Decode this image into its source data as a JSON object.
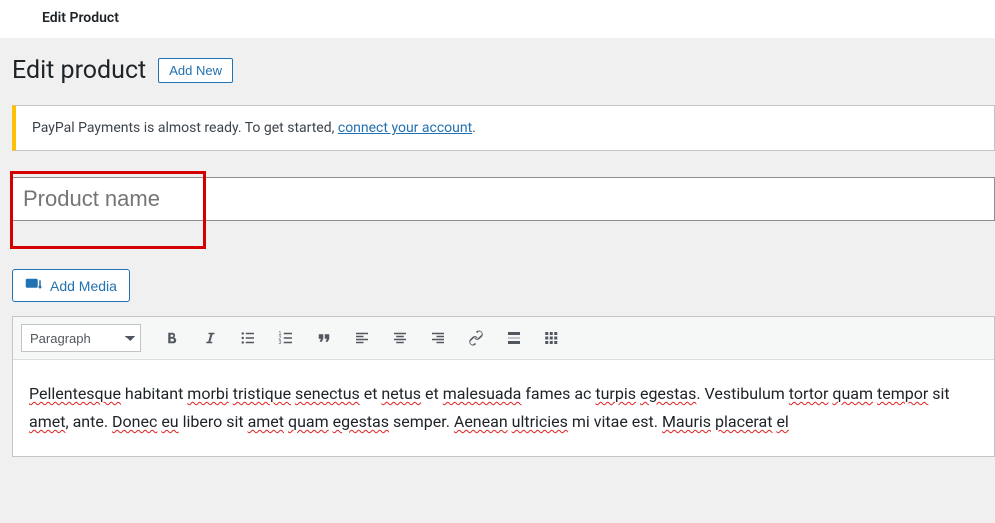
{
  "top_bar": {
    "breadcrumb": "Edit Product"
  },
  "heading": {
    "title": "Edit product",
    "add_new_label": "Add New"
  },
  "notice": {
    "text_before": "PayPal Payments is almost ready. To get started, ",
    "link_text": "connect your account",
    "text_after": "."
  },
  "title_input": {
    "placeholder": "Product name"
  },
  "add_media_label": "Add Media",
  "toolbar": {
    "format_selected": "Paragraph"
  },
  "content": {
    "w1": "Pellentesque",
    "t1": " habitant ",
    "w2": "morbi",
    "t2": " ",
    "w3": "tristique",
    "t3": " ",
    "w4": "senectus",
    "t4": " et ",
    "w5": "netus",
    "t5": " et ",
    "w6": "malesuada",
    "t6": " fames ac ",
    "w7": "turpis",
    "t7": " ",
    "w8": "egestas",
    "t8": ". Vestibulum ",
    "w9": "tortor",
    "t9": " ",
    "w10": "quam",
    "t10": " ",
    "w11": "tempor",
    "t11": " sit ",
    "w12": "amet",
    "t12": ", ante. ",
    "w13": "Donec",
    "t13": " ",
    "w14": "eu",
    "t14": " libero sit ",
    "w15": "amet",
    "t15": " ",
    "w16": "quam",
    "t16": " ",
    "w17": "egestas",
    "t17": " semper. ",
    "w18": "Aenean",
    "t18": " ",
    "w19": "ultricies",
    "t19": " mi vitae est. ",
    "w20": "Mauris",
    "t20": " ",
    "w21": "placerat",
    "t21": " ",
    "w22": "el"
  }
}
